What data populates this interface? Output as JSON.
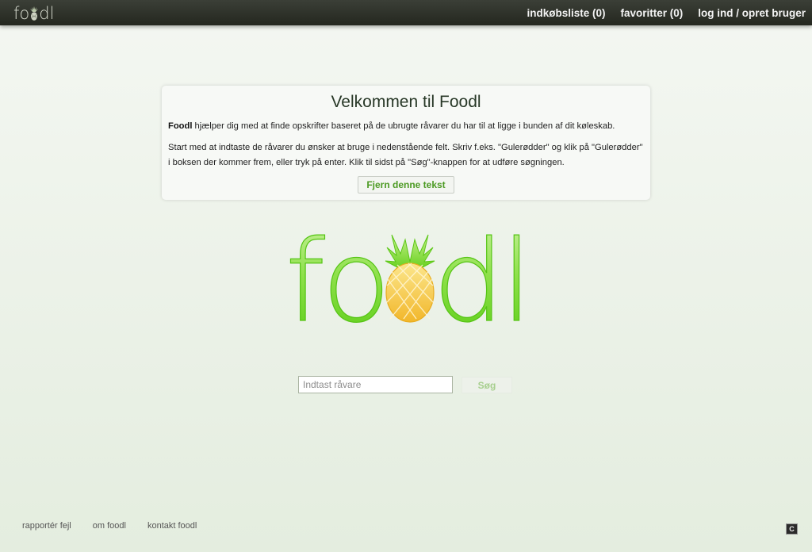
{
  "header": {
    "brand_left": "fo",
    "brand_right": "dl",
    "nav": {
      "shopping_list": "indkøbsliste (0)",
      "favorites": "favoritter (0)",
      "login": "log ind / opret bruger"
    }
  },
  "welcome": {
    "title": "Velkommen til Foodl",
    "intro_bold": "Foodl",
    "intro_rest": " hjælper dig med at finde opskrifter baseret på de ubrugte råvarer du har til at ligge i bunden af dit køleskab.",
    "instructions": "Start med at indtaste de råvarer du ønsker at bruge i nedenstående felt. Skriv f.eks. \"Gulerødder\" og klik på \"Gulerødder\" i boksen der kommer frem, eller tryk på enter. Klik til sidst på \"Søg\"-knappen for at udføre søgningen.",
    "dismiss_label": "Fjern denne tekst"
  },
  "logo": {
    "left": "fo",
    "right": "dl"
  },
  "search": {
    "placeholder": "Indtast råvare",
    "value": "",
    "button_label": "Søg"
  },
  "footer": {
    "links": [
      "rapportér fejl",
      "om foodl",
      "kontakt foodl"
    ]
  },
  "corner_badge": "C",
  "colors": {
    "accent_green": "#4c9a23",
    "logo_green": "#6ed62a",
    "pineapple_yellow": "#f5c93b",
    "topbar": "#2a2d25"
  },
  "icons": {
    "brand_pineapple": "pineapple-icon",
    "logo_pineapple": "pineapple-icon"
  }
}
